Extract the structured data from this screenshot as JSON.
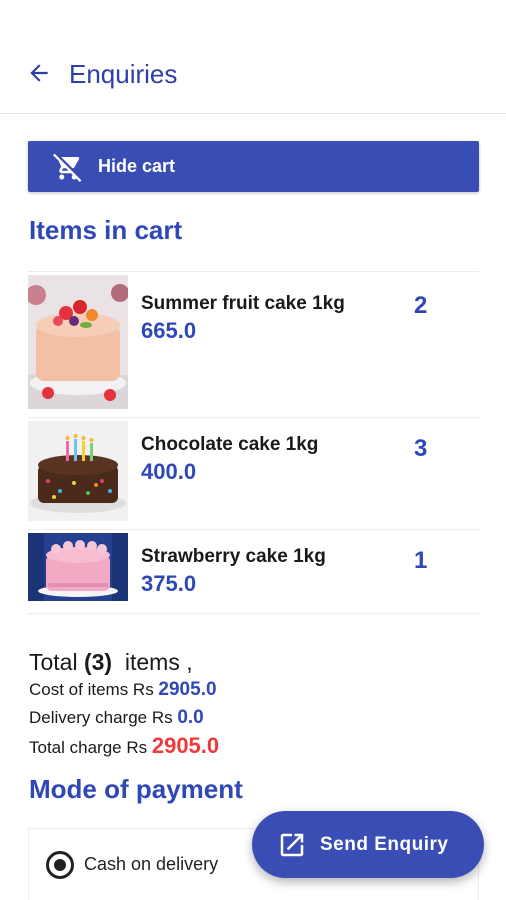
{
  "appbar": {
    "title": "Enquiries"
  },
  "hide_cart": {
    "label": "Hide cart"
  },
  "cart": {
    "heading": "Items in cart",
    "items": [
      {
        "name": "Summer fruit cake 1kg",
        "price": "665.0",
        "qty": "2"
      },
      {
        "name": "Chocolate cake 1kg",
        "price": "400.0",
        "qty": "3"
      },
      {
        "name": "Strawberry cake 1kg",
        "price": "375.0",
        "qty": "1"
      }
    ]
  },
  "summary": {
    "total_prefix": "Total ",
    "total_count": "(3)",
    "total_suffix": "  items ,",
    "cost_label": "Cost of items Rs ",
    "cost_value": "2905.0",
    "delivery_label": "Delivery charge Rs ",
    "delivery_value": "0.0",
    "total_charge_label": "Total charge Rs ",
    "total_charge_value": "2905.0"
  },
  "payment": {
    "heading": "Mode of payment",
    "option_label": "Cash on delivery"
  },
  "fab": {
    "label": "Send Enquiry"
  },
  "colors": {
    "primary": "#3a4db5",
    "heading": "#2f48b8",
    "danger": "#f03a3a"
  },
  "icons": {
    "back": "arrow-left-icon",
    "hide_cart": "remove-shopping-cart-icon",
    "send": "open-in-new-icon"
  }
}
